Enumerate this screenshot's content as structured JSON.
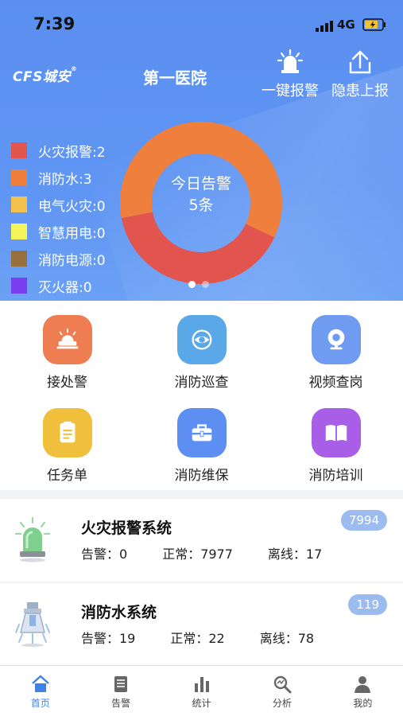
{
  "status_bar": {
    "time": "7:39",
    "network": "4G"
  },
  "header": {
    "logo": "CFS城安",
    "logo_mark": "®",
    "hospital": "第一医院",
    "actions": [
      {
        "label": "一键报警",
        "icon": "alarm-light-icon"
      },
      {
        "label": "隐患上报",
        "icon": "upload-icon"
      }
    ]
  },
  "summary": {
    "center_title": "今日告警",
    "center_value": "5条",
    "legend": [
      {
        "label": "火灾报警:2",
        "color": "#e2544e"
      },
      {
        "label": "消防水:3",
        "color": "#ef7f3d"
      },
      {
        "label": "电气火灾:0",
        "color": "#f2c14e"
      },
      {
        "label": "智慧用电:0",
        "color": "#f7f35a"
      },
      {
        "label": "消防电源:0",
        "color": "#9a6f3e"
      },
      {
        "label": "灭火器:0",
        "color": "#7a3ff0"
      }
    ],
    "page_dots": 2,
    "active_dot": 0
  },
  "chart_data": {
    "type": "pie",
    "labels": [
      "火灾报警",
      "消防水",
      "电气火灾",
      "智慧用电",
      "消防电源",
      "灭火器"
    ],
    "values": [
      2,
      3,
      0,
      0,
      0,
      0
    ],
    "colors": [
      "#e2544e",
      "#ef7f3d",
      "#f2c14e",
      "#f7f35a",
      "#9a6f3e",
      "#7a3ff0"
    ]
  },
  "features": [
    {
      "label": "接处警",
      "icon": "alarm-handle-icon",
      "color": "#ee7d52"
    },
    {
      "label": "消防巡查",
      "icon": "patrol-eye-icon",
      "color": "#5aa8e8"
    },
    {
      "label": "视频查岗",
      "icon": "webcam-icon",
      "color": "#6f9bf0"
    },
    {
      "label": "任务单",
      "icon": "clipboard-icon",
      "color": "#f0c03c"
    },
    {
      "label": "消防维保",
      "icon": "toolbox-icon",
      "color": "#5d8ff2"
    },
    {
      "label": "消防培训",
      "icon": "book-icon",
      "color": "#a85ee6"
    }
  ],
  "systems": [
    {
      "title": "火灾报警系统",
      "badge": "7994",
      "alarm": "告警：0",
      "normal": "正常：7977",
      "offline": "离线：17",
      "icon": "fire-alarm-light-icon"
    },
    {
      "title": "消防水系统",
      "badge": "119",
      "alarm": "告警：19",
      "normal": "正常：22",
      "offline": "离线：78",
      "icon": "sprinkler-icon"
    }
  ],
  "tabs": [
    {
      "label": "首页",
      "icon": "home-icon",
      "active": true
    },
    {
      "label": "告警",
      "icon": "document-icon",
      "active": false
    },
    {
      "label": "统计",
      "icon": "bar-chart-icon",
      "active": false
    },
    {
      "label": "分析",
      "icon": "analysis-search-icon",
      "active": false
    },
    {
      "label": "我的",
      "icon": "person-icon",
      "active": false
    }
  ]
}
